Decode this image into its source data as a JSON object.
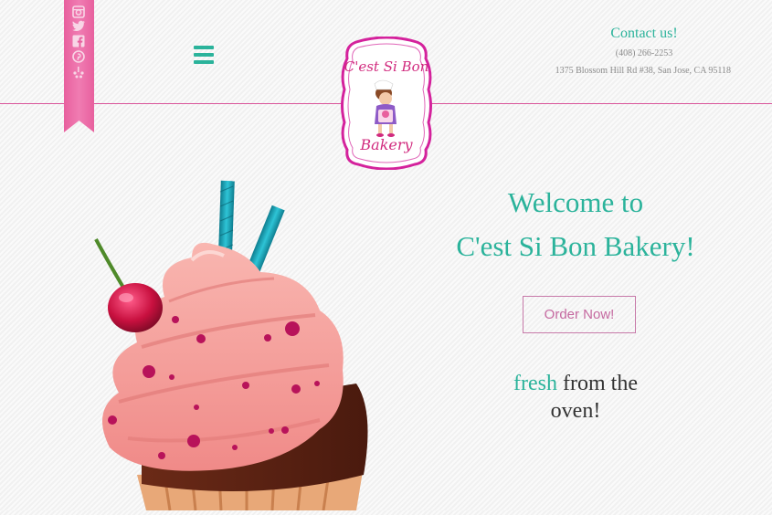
{
  "social": {
    "icons": [
      "instagram-icon",
      "twitter-icon",
      "facebook-icon",
      "pinterest-icon",
      "yelp-icon"
    ]
  },
  "nav": {
    "menu_icon": "hamburger-menu-icon"
  },
  "logo": {
    "line1": "C'est Si Bon",
    "line2": "Bakery"
  },
  "contact": {
    "title": "Contact us!",
    "phone": "(408) 266-2253",
    "address": "1375 Blossom Hill Rd #38, San Jose, CA 95118"
  },
  "hero": {
    "welcome_line1": "Welcome to",
    "welcome_line2": "C'est Si Bon Bakery!",
    "order_button": "Order Now!",
    "tagline_highlight": "fresh",
    "tagline_rest1": " from the",
    "tagline_rest2": "oven!"
  },
  "colors": {
    "accent_teal": "#2bb39b",
    "accent_pink": "#d9559a",
    "ribbon_pink": "#e8609e"
  }
}
